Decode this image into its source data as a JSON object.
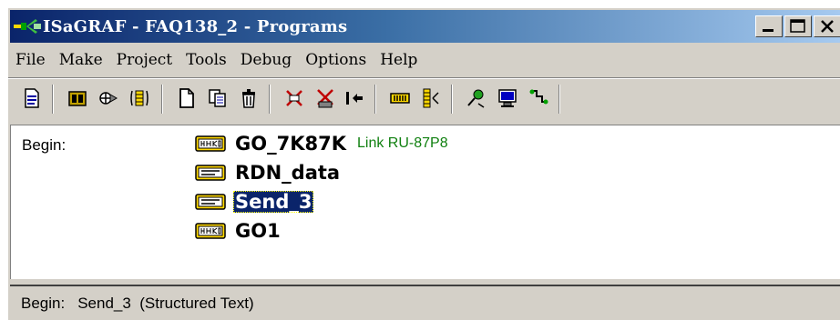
{
  "window": {
    "title": "ISaGRAF - FAQ138_2 - Programs",
    "app_icon": "isagraf-app-icon",
    "buttons": [
      "minimize-button",
      "maximize-button",
      "close-button"
    ]
  },
  "menu": [
    "File",
    "Make",
    "Project",
    "Tools",
    "Debug",
    "Options",
    "Help"
  ],
  "toolbar": {
    "icons": [
      "page-properties-icon",
      "dictionary-icon",
      "compile-icon",
      "io-connection-icon",
      "new-program-icon",
      "copy-program-icon",
      "delete-program-icon",
      "simulate-icon",
      "stop-icon",
      "move-program-icon",
      "io-library-icon",
      "variables-icon",
      "debug-link-icon",
      "monitor-icon",
      "code-generator-icon"
    ]
  },
  "content": {
    "section_label": "Begin:",
    "programs": [
      {
        "name": "GO_7K87K",
        "icon": "ladder-program-icon",
        "link": "Link RU-87P8",
        "selected": false
      },
      {
        "name": "RDN_data",
        "icon": "structured-text-program-icon",
        "link": "",
        "selected": false
      },
      {
        "name": "Send_3",
        "icon": "structured-text-program-icon",
        "link": "",
        "selected": true
      },
      {
        "name": "GO1",
        "icon": "ladder-program-icon",
        "link": "",
        "selected": false
      }
    ]
  },
  "status": {
    "label": "Begin:",
    "text": "Send_3  (Structured Text)"
  },
  "colors": {
    "title_gradient_start": "#0a246a",
    "title_gradient_end": "#a6caf0",
    "selection": "#0a246a",
    "link_text": "#108010",
    "face": "#d4d0c8"
  }
}
